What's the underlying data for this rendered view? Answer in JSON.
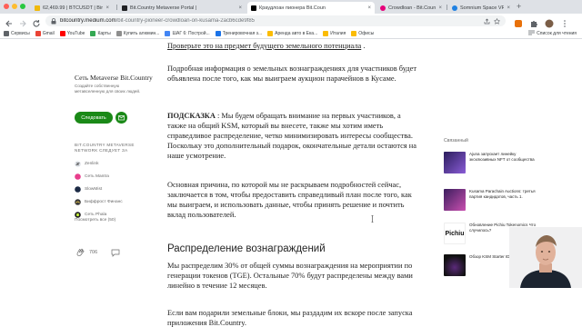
{
  "browser": {
    "tabs": [
      {
        "label": "62,469.99 | BTCUSDT | Binan",
        "favicon_color": "#f0b90b",
        "active": false
      },
      {
        "label": "Bit.Country Metaverse Portal |",
        "favicon_color": "#202124",
        "active": false
      },
      {
        "label": "Краудлоан пионера Bit.Coun",
        "favicon_color": "#000000",
        "active": true
      },
      {
        "label": "Crowdloan - Bit.Country Pione",
        "favicon_color": "#e6007a",
        "active": false
      },
      {
        "label": "Somnium Space VR - Collectio",
        "favicon_color": "#2081e2",
        "active": false
      }
    ],
    "url_host": "bitcountry.medium.com",
    "url_path": "/bit-country-pioneer-crowdloan-on-kusama-2acb6cde9f85",
    "bookmarks": [
      {
        "label": "Сервисы",
        "favicon_color": "#5f6368"
      },
      {
        "label": "Gmail",
        "favicon_color": "#ea4335"
      },
      {
        "label": "YouTube",
        "favicon_color": "#ff0000"
      },
      {
        "label": "Карты",
        "favicon_color": "#34a853"
      },
      {
        "label": "Купить алюмин...",
        "favicon_color": "#8e8e8e"
      },
      {
        "label": "ШАГ 6: Построй...",
        "favicon_color": "#4285f4"
      },
      {
        "label": "Тренировочная з...",
        "favicon_color": "#1a73e8"
      },
      {
        "label": "Аренда авто в Ека...",
        "favicon_color": "#fbbc04"
      },
      {
        "label": "Италия",
        "favicon_color": "#fbbc04"
      },
      {
        "label": "Офисы",
        "favicon_color": "#fbbc04"
      }
    ],
    "reading_list": "Список для чтения"
  },
  "sidebar": {
    "author_name": "Сеть Metaverse Bit.Country",
    "author_desc": "Создайте собственную метавселенную для своих людей.",
    "follow_label": "Следовать",
    "publication": "BIT.COUNTRY METAVERSE NETWORK СЛЕДУЕТ ЗА",
    "links": [
      {
        "label": "Zenlink",
        "icon": "zenlink-icon"
      },
      {
        "label": "Сеть Mantra",
        "icon": "mantra-icon"
      },
      {
        "label": "SlowMist",
        "icon": "slowmist-icon"
      },
      {
        "label": "Биффрост Финанс",
        "icon": "bifrost-icon"
      },
      {
        "label": "Сеть Phala",
        "icon": "phala-icon"
      }
    ],
    "more_from": "Посмотреть все (50)",
    "claps": "706"
  },
  "article": {
    "top_link": "Проверьте это на предмет будущего земельного потенциала",
    "top_link_tail": " .",
    "para1": "Подробная информация о земельных вознаграждениях для участников будет объявлена после того, как мы выиграем аукцион парачейнов в Кусаме.",
    "hint_label": "ПОДСКАЗКА",
    "hint_text": " : Мы будем обращать внимание на первых участников, а также на общий KSM, который вы внесете, также мы хотим иметь справедливое распределение, четко минимизировать интересы сообщества. Поскольку это дополнительный подарок, окончательные детали остаются на наше усмотрение.",
    "para3": "Основная причина, по которой мы не раскрываем подробностей сейчас, заключается в том, чтобы предоставить справедливый план после того, как мы выиграем, и использовать данные, чтобы принять решение и почтить вклад пользователей.",
    "section_title": "Распределение вознаграждений",
    "para4": "Мы распределим 30% от общей суммы вознаграждения на мероприятии по генерации токенов (TGE). Остальные 70% будут распределены между вами линейно в течение 12 месяцев.",
    "para5": "Если вам подарили земельные блоки, мы раздадим их вскоре после запуска приложения Bit.Country."
  },
  "related": {
    "title": "Связанный",
    "items": [
      {
        "title": "Ajuna запускает линейку эксклюзивных NFT от сообщества",
        "thumb": "#3a2a6e"
      },
      {
        "title": "Kusama Parachain Auctions: третья партия кандидатов, часть 1.",
        "thumb": "#6b2f8a"
      },
      {
        "title": "Обновление Pichiu Tokenomics Что случилось?",
        "thumb_text": "Pichiu",
        "thumb": "#ffffff"
      },
      {
        "title": "Обзор KSM Starter IDO: сеть Integritee",
        "thumb": "#1a1a1a"
      }
    ]
  },
  "colors": {
    "accent": "#1a8917",
    "text": "#242424",
    "muted": "#6b6b6b"
  }
}
